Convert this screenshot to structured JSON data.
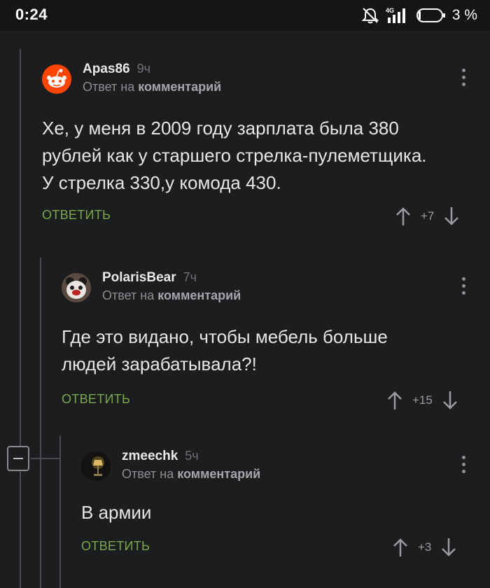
{
  "status_bar": {
    "time": "0:24",
    "network": "4G",
    "battery": "3 %"
  },
  "comments": [
    {
      "username": "Apas86",
      "time": "9ч",
      "reply_prefix": "Ответ на",
      "reply_target": "комментарий",
      "body_lines": [
        "Хе, у меня в 2009 году зарплата была 380",
        "рублей как у старшего стрелка-пулеметщика.",
        "У стрелка 330,у комода 430."
      ],
      "reply_label": "ОТВЕТИТЬ",
      "rating": "+7"
    },
    {
      "username": "PolarisBear",
      "time": "7ч",
      "reply_prefix": "Ответ на",
      "reply_target": "комментарий",
      "body_lines": [
        "Где это видано, чтобы мебель больше",
        "людей зарабатывала?!"
      ],
      "reply_label": "ОТВЕТИТЬ",
      "rating": "+15"
    },
    {
      "username": "zmeechk",
      "time": "5ч",
      "reply_prefix": "Ответ на",
      "reply_target": "комментарий",
      "body_lines": [
        "В армии"
      ],
      "reply_label": "ОТВЕТИТЬ",
      "rating": "+3"
    }
  ],
  "colors": {
    "background": "#1c1d1f",
    "reply_green": "#7aa84a",
    "thread_line": "#4a4b4e"
  }
}
